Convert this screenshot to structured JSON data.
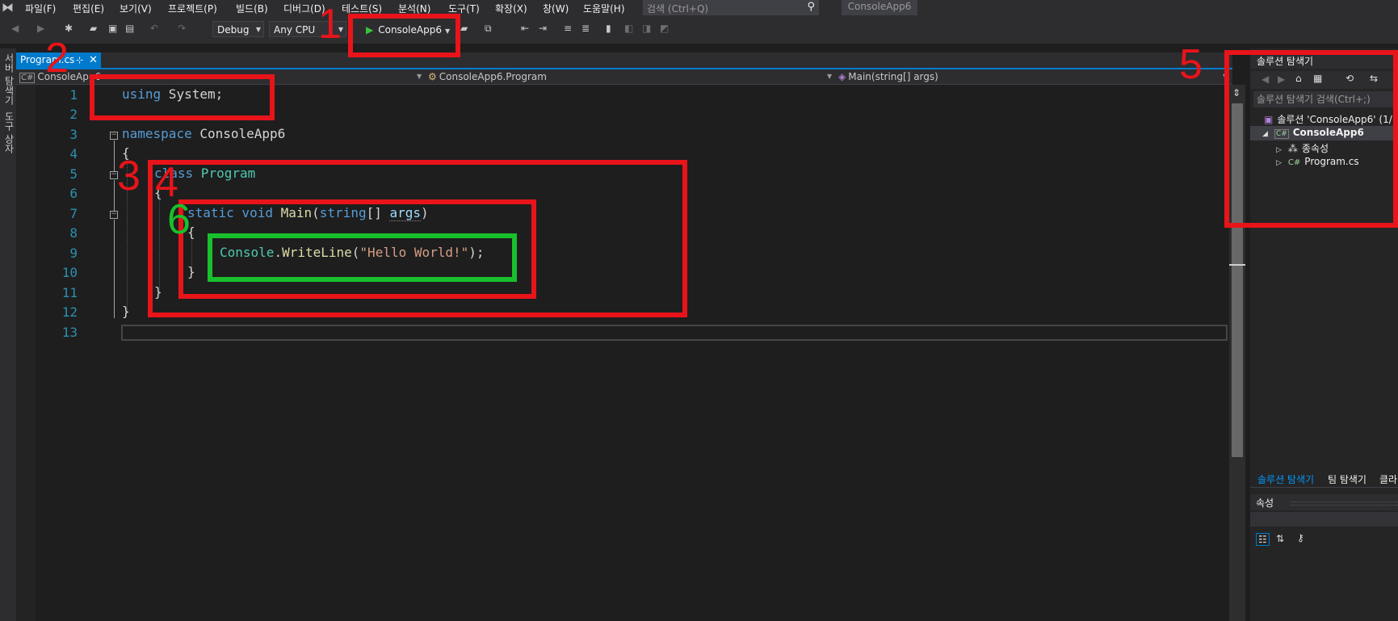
{
  "menu": {
    "items": [
      "파일(F)",
      "편집(E)",
      "보기(V)",
      "프로젝트(P)",
      "빌드(B)",
      "디버그(D)",
      "테스트(S)",
      "분석(N)",
      "도구(T)",
      "확장(X)",
      "창(W)",
      "도움말(H)"
    ],
    "search_placeholder": "검색 (Ctrl+Q)",
    "title": "ConsoleApp6"
  },
  "toolbar": {
    "config": "Debug",
    "platform": "Any CPU",
    "run_label": "ConsoleApp6"
  },
  "left_strip": {
    "server_explorer": "서버 탐색기",
    "toolbox": "도구 상자"
  },
  "editor": {
    "tab_label": "Program.cs",
    "nav_project": "ConsoleApp6",
    "nav_class": "ConsoleApp6.Program",
    "nav_member": "Main(string[] args)",
    "line_numbers": [
      "1",
      "2",
      "3",
      "4",
      "5",
      "6",
      "7",
      "8",
      "9",
      "10",
      "11",
      "12",
      "13"
    ],
    "code": {
      "l1_kw": "using",
      "l1_rest": " System;",
      "l3_kw": "namespace",
      "l3_rest": " ConsoleApp6",
      "l4": "{",
      "l5_kw": "class",
      "l5_ty": " Program",
      "l6": "{",
      "l7_kw1": "static",
      "l7_kw2": " void",
      "l7_fn": " Main",
      "l7_p1": "(",
      "l7_kw3": "string",
      "l7_p2": "[] ",
      "l7_pa": "args",
      "l7_p3": ")",
      "l8": "{",
      "l9_ty": "Console",
      "l9_dot": ".",
      "l9_fn": "WriteLine",
      "l9_p1": "(",
      "l9_st": "\"Hello World!\"",
      "l9_p2": ");",
      "l10": "}",
      "l11": "}",
      "l12": "}"
    }
  },
  "solution_explorer": {
    "title": "솔루션 탐색기",
    "search_placeholder": "솔루션 탐색기 검색(Ctrl+;)",
    "solution_label": "솔루션 'ConsoleApp6' (1/",
    "project_label": "ConsoleApp6",
    "dependencies_label": "종속성",
    "file_label": "Program.cs",
    "bottom_tabs": [
      "솔루션 탐색기",
      "팀 탐색기",
      "클라"
    ],
    "properties_title": "속성"
  },
  "annotations": {
    "red_labels": [
      "1",
      "2",
      "3",
      "4",
      "5"
    ],
    "green_label": "6"
  },
  "colors": {
    "annotation_red": "#e8141a",
    "annotation_green": "#18c02b",
    "accent": "#007acc"
  }
}
